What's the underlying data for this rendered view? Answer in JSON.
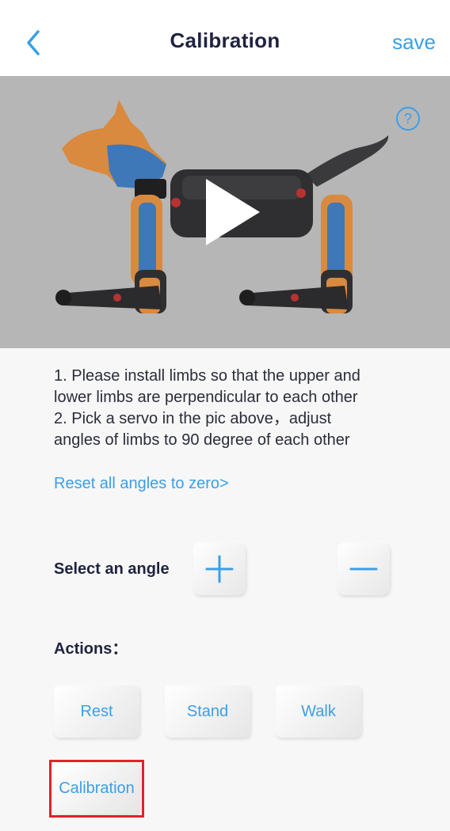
{
  "header": {
    "title": "Calibration",
    "save_label": "save",
    "accent_color": "#3a9fe8"
  },
  "picture": {
    "background_color": "#b6b6b6",
    "icons": [
      "robot-dog-illustration",
      "help-icon",
      "play-icon"
    ]
  },
  "instructions": {
    "lines": [
      "1. Please install limbs so that the upper and",
      "lower limbs are perpendicular to each other",
      "2. Pick a servo in the pic above，adjust",
      "angles of limbs to 90 degree of each other"
    ]
  },
  "reset_link": "Reset all angles to zero>",
  "angle": {
    "label": "Select an angle",
    "increase_icon": "plus-icon",
    "decrease_icon": "minus-icon"
  },
  "actions": {
    "label": "Actions：",
    "buttons": [
      "Rest",
      "Stand",
      "Walk",
      "Calibration"
    ]
  },
  "highlight_color": "#e0232b"
}
